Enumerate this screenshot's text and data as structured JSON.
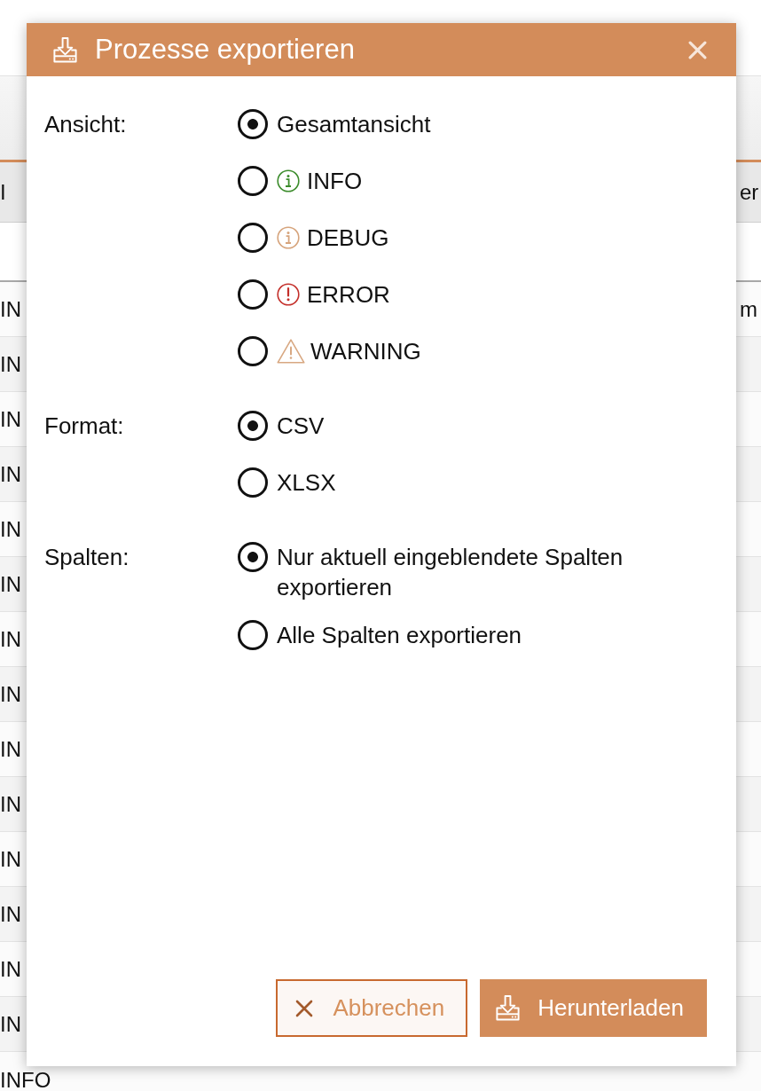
{
  "background_table": {
    "columns": {
      "column_1": "I",
      "column_2": "er"
    },
    "rows": [
      {
        "column_1": "IN",
        "column_2": "m"
      },
      {
        "column_1": "IN"
      },
      {
        "column_1": "IN"
      },
      {
        "column_1": "IN"
      },
      {
        "column_1": "IN"
      },
      {
        "column_1": "IN"
      },
      {
        "column_1": "IN"
      },
      {
        "column_1": "IN"
      },
      {
        "column_1": "IN"
      },
      {
        "column_1": "IN"
      },
      {
        "column_1": "IN"
      },
      {
        "column_1": "IN"
      },
      {
        "column_1": "IN"
      },
      {
        "column_1": "IN"
      },
      {
        "column_1": "INFO"
      }
    ]
  },
  "dialog": {
    "title": "Prozesse exportieren",
    "groups": [
      {
        "label": "Ansicht:",
        "options": [
          {
            "label": "Gesamtansicht",
            "kind": "plain",
            "selected": true
          },
          {
            "label": "INFO",
            "kind": "info",
            "color": "#3c8c2c",
            "selected": false
          },
          {
            "label": "DEBUG",
            "kind": "info",
            "color": "#d6a47c",
            "selected": false
          },
          {
            "label": "ERROR",
            "kind": "alert",
            "color": "#c4302b",
            "selected": false
          },
          {
            "label": "WARNING",
            "kind": "warning",
            "color": "#d8a882",
            "selected": false
          }
        ]
      },
      {
        "label": "Format:",
        "options": [
          {
            "label": "CSV",
            "kind": "plain",
            "selected": true
          },
          {
            "label": "XLSX",
            "kind": "plain",
            "selected": false
          }
        ]
      },
      {
        "label": "Spalten:",
        "options": [
          {
            "label": "Nur aktuell eingeblendete Spalten exportieren",
            "kind": "plain",
            "selected": true
          },
          {
            "label": "Alle Spalten exportieren",
            "kind": "plain",
            "selected": false
          }
        ]
      }
    ],
    "buttons": [
      {
        "label": "Abbrechen",
        "kind": "secondary"
      },
      {
        "label": "Herunterladen",
        "kind": "primary"
      }
    ]
  }
}
